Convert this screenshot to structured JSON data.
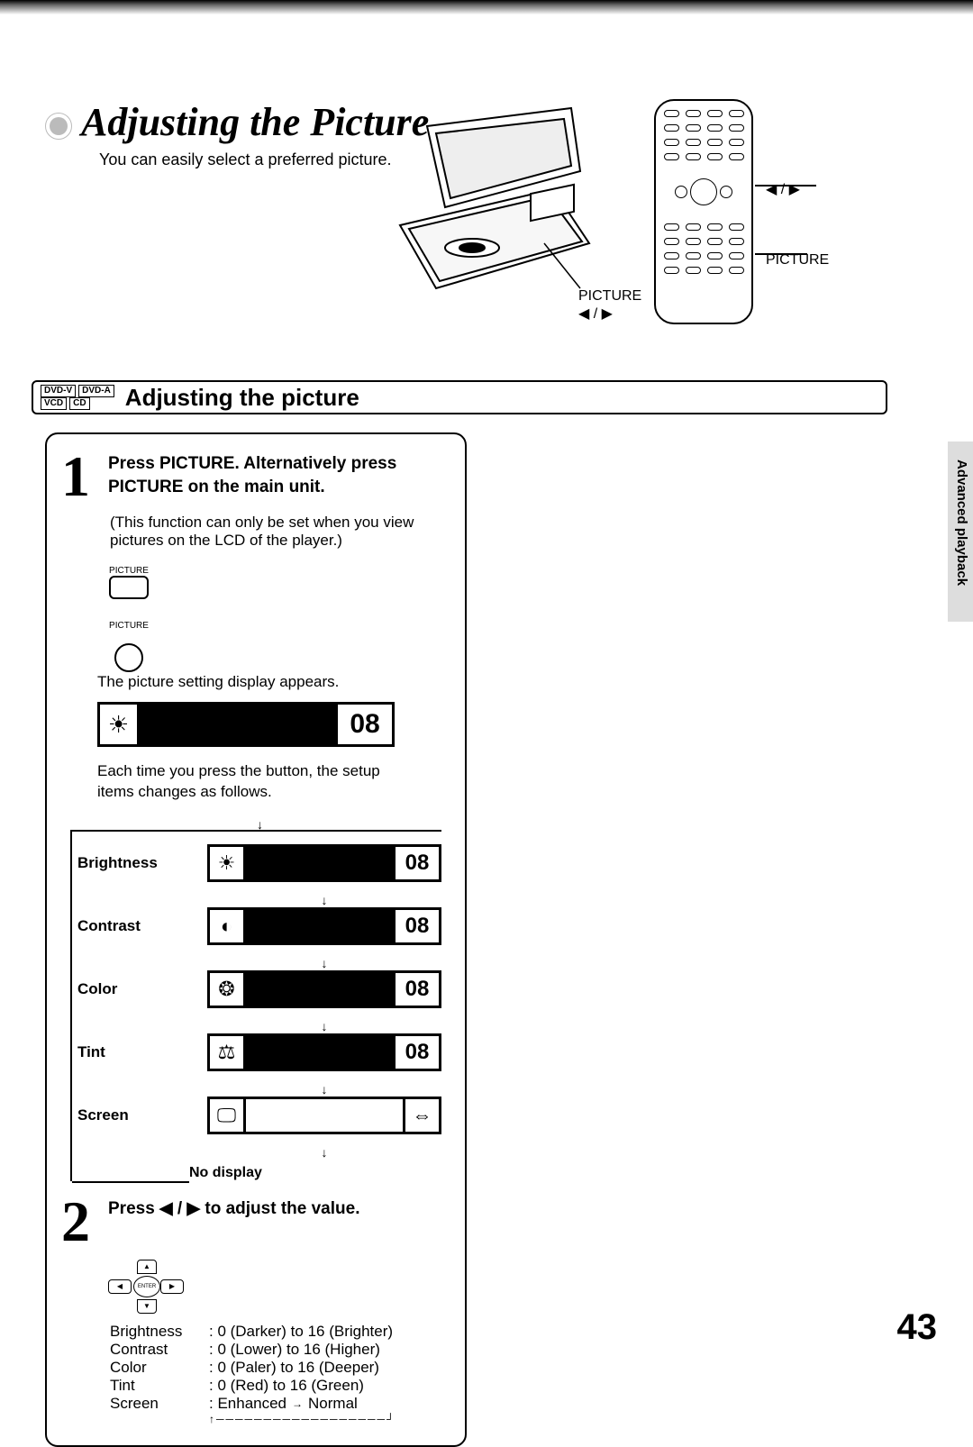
{
  "page": {
    "title": "Adjusting the Picture",
    "subtitle": "You can easily select a preferred picture.",
    "section_title": "Adjusting the picture",
    "number": "43",
    "side_tab": "Advanced playback"
  },
  "disc_badges": [
    "DVD-V",
    "DVD-A",
    "VCD",
    "CD"
  ],
  "device_labels": {
    "picture": "PICTURE",
    "arrows": "◀ / ▶"
  },
  "remote_labels": {
    "arrows": "◀ / ▶",
    "picture": "PICTURE"
  },
  "step1": {
    "num": "1",
    "heading": "Press PICTURE. Alternatively press PICTURE on the main unit.",
    "note": "(This function can only be set when you view pictures on the LCD of the player.)",
    "button_label_top": "PICTURE",
    "button_label_bottom": "PICTURE",
    "desc1": "The picture setting display appears.",
    "osd_example_value": "08",
    "desc2": "Each time you press the button, the setup items changes as follows."
  },
  "cycle": {
    "items": [
      {
        "label": "Brightness",
        "icon": "☀",
        "value": "08"
      },
      {
        "label": "Contrast",
        "icon": "◐",
        "value": "08"
      },
      {
        "label": "Color",
        "icon": "❂",
        "value": "08"
      },
      {
        "label": "Tint",
        "icon": "⚖",
        "value": "08"
      }
    ],
    "screen_label": "Screen",
    "screen_icon1": "🖵",
    "screen_icon2": "⇔",
    "no_display": "No display"
  },
  "step2": {
    "num": "2",
    "heading": "Press ◀ / ▶ to adjust the value.",
    "ranges": [
      {
        "name": "Brightness",
        "desc": ": 0 (Darker) to 16 (Brighter)"
      },
      {
        "name": "Contrast",
        "desc": ": 0 (Lower) to 16 (Higher)"
      },
      {
        "name": "Color",
        "desc": ": 0 (Paler) to 16 (Deeper)"
      },
      {
        "name": "Tint",
        "desc": ": 0 (Red) to 16 (Green)"
      }
    ],
    "screen_name": "Screen",
    "screen_desc_a": ": Enhanced",
    "screen_desc_b": "Normal"
  }
}
